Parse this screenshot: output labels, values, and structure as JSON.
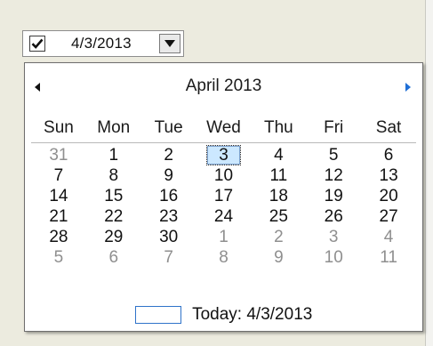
{
  "date_picker": {
    "checked": true,
    "value": "4/3/2013"
  },
  "calendar": {
    "month_title": "April 2013",
    "weekdays": [
      "Sun",
      "Mon",
      "Tue",
      "Wed",
      "Thu",
      "Fri",
      "Sat"
    ],
    "weeks": [
      [
        {
          "d": "31",
          "other": true
        },
        {
          "d": "1"
        },
        {
          "d": "2"
        },
        {
          "d": "3",
          "selected": true
        },
        {
          "d": "4"
        },
        {
          "d": "5"
        },
        {
          "d": "6"
        }
      ],
      [
        {
          "d": "7"
        },
        {
          "d": "8"
        },
        {
          "d": "9"
        },
        {
          "d": "10"
        },
        {
          "d": "11"
        },
        {
          "d": "12"
        },
        {
          "d": "13"
        }
      ],
      [
        {
          "d": "14"
        },
        {
          "d": "15"
        },
        {
          "d": "16"
        },
        {
          "d": "17"
        },
        {
          "d": "18"
        },
        {
          "d": "19"
        },
        {
          "d": "20"
        }
      ],
      [
        {
          "d": "21"
        },
        {
          "d": "22"
        },
        {
          "d": "23"
        },
        {
          "d": "24"
        },
        {
          "d": "25"
        },
        {
          "d": "26"
        },
        {
          "d": "27"
        }
      ],
      [
        {
          "d": "28"
        },
        {
          "d": "29"
        },
        {
          "d": "30"
        },
        {
          "d": "1",
          "other": true
        },
        {
          "d": "2",
          "other": true
        },
        {
          "d": "3",
          "other": true
        },
        {
          "d": "4",
          "other": true
        }
      ],
      [
        {
          "d": "5",
          "other": true
        },
        {
          "d": "6",
          "other": true
        },
        {
          "d": "7",
          "other": true
        },
        {
          "d": "8",
          "other": true
        },
        {
          "d": "9",
          "other": true
        },
        {
          "d": "10",
          "other": true
        },
        {
          "d": "11",
          "other": true
        }
      ]
    ],
    "today_label": "Today: 4/3/2013"
  },
  "icons": {
    "checkbox": "check-icon",
    "dropdown": "chevron-down-icon",
    "prev": "arrow-left-icon",
    "next": "arrow-right-icon"
  },
  "colors": {
    "selected_bg": "#cce8ff",
    "next_arrow": "#1f6fd6",
    "other_month_text": "#8f8f8f",
    "today_box_border": "#2f73c9"
  }
}
